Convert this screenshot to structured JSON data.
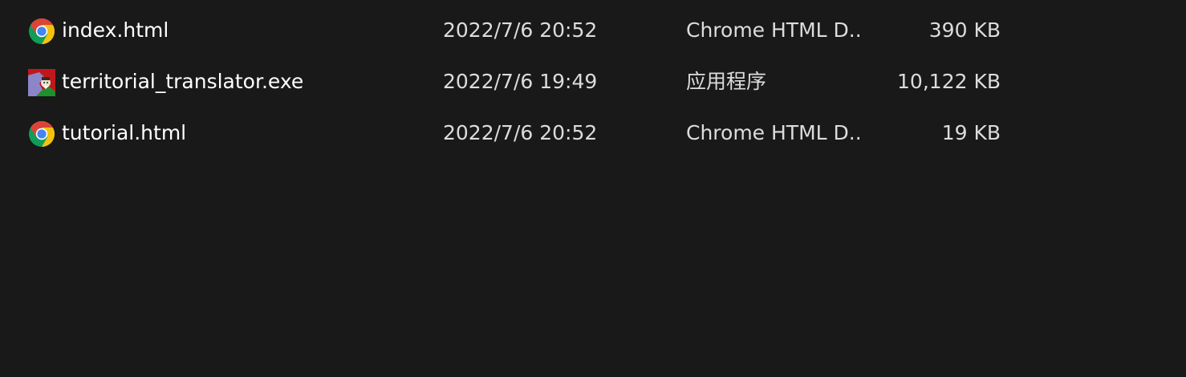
{
  "files": [
    {
      "name": "index.html",
      "date_modified": "2022/7/6 20:52",
      "type": "Chrome HTML D...",
      "size": "390 KB",
      "icon": "chrome-icon"
    },
    {
      "name": "territorial_translator.exe",
      "date_modified": "2022/7/6 19:49",
      "type": "应用程序",
      "size": "10,122 KB",
      "icon": "application-icon"
    },
    {
      "name": "tutorial.html",
      "date_modified": "2022/7/6 20:52",
      "type": "Chrome HTML D...",
      "size": "19 KB",
      "icon": "chrome-icon"
    }
  ],
  "colors": {
    "background": "#191919",
    "text_primary": "#ffffff",
    "text_secondary": "#dcdcdc",
    "chrome_red": "#db4437",
    "chrome_yellow": "#f4c20d",
    "chrome_green": "#0f9d58",
    "chrome_blue": "#4285f4"
  }
}
